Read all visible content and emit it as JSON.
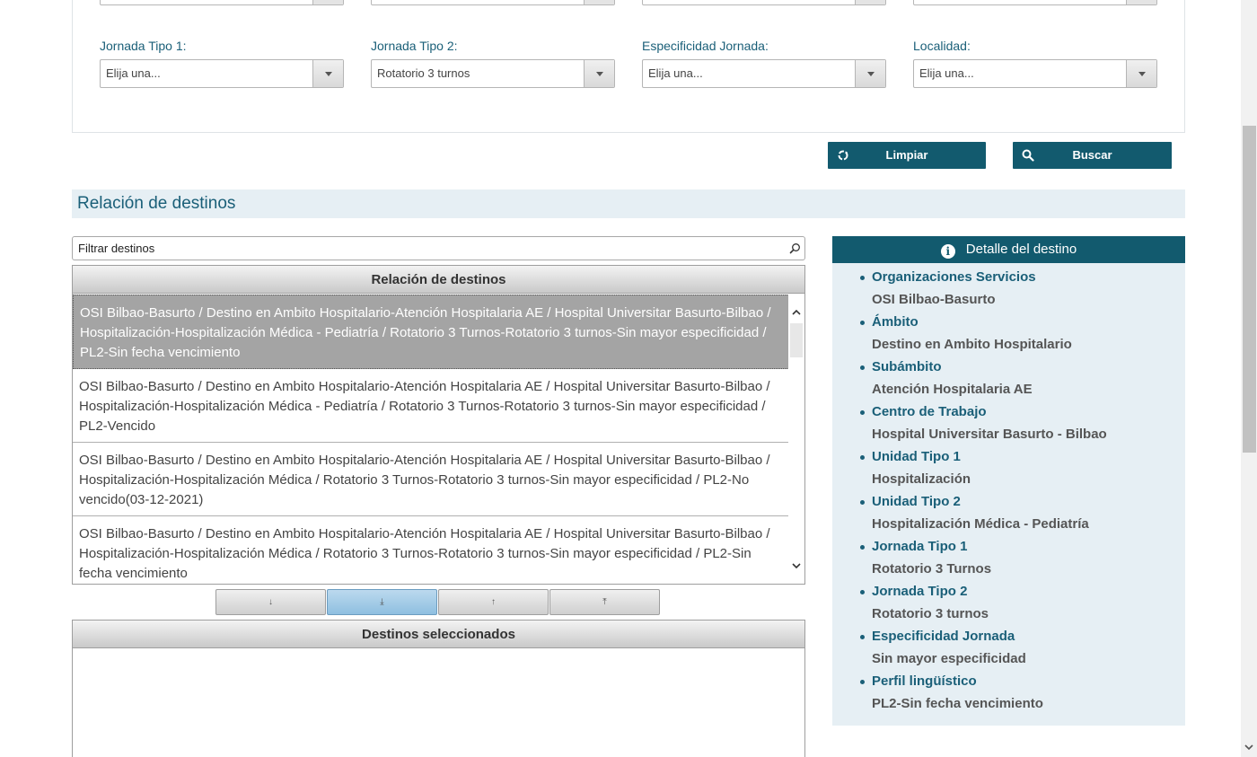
{
  "filters": {
    "fields": [
      {
        "label": "Jornada Tipo 1:",
        "value": "Elija una..."
      },
      {
        "label": "Jornada Tipo 2:",
        "value": "Rotatorio 3 turnos"
      },
      {
        "label": "Especificidad Jornada:",
        "value": "Elija una..."
      },
      {
        "label": "Localidad:",
        "value": "Elija una..."
      }
    ]
  },
  "buttons": {
    "clear": "Limpiar",
    "search": "Buscar"
  },
  "section": {
    "title": "Relación de destinos"
  },
  "filter_input": {
    "placeholder": "Filtrar destinos"
  },
  "list": {
    "header": "Relación de destinos",
    "items": [
      "OSI Bilbao-Basurto / Destino en Ambito Hospitalario-Atención Hospitalaria AE / Hospital Universitar Basurto-Bilbao / Hospitalización-Hospitalización Médica - Pediatría / Rotatorio 3 Turnos-Rotatorio 3 turnos-Sin mayor especificidad / PL2-Sin fecha vencimiento",
      "OSI Bilbao-Basurto / Destino en Ambito Hospitalario-Atención Hospitalaria AE / Hospital Universitar Basurto-Bilbao / Hospitalización-Hospitalización Médica - Pediatría / Rotatorio 3 Turnos-Rotatorio 3 turnos-Sin mayor especificidad / PL2-Vencido",
      "OSI Bilbao-Basurto / Destino en Ambito Hospitalario-Atención Hospitalaria AE / Hospital Universitar Basurto-Bilbao / Hospitalización-Hospitalización Médica / Rotatorio 3 Turnos-Rotatorio 3 turnos-Sin mayor especificidad / PL2-No vencido(03-12-2021)",
      "OSI Bilbao-Basurto / Destino en Ambito Hospitalario-Atención Hospitalaria AE / Hospital Universitar Basurto-Bilbao / Hospitalización-Hospitalización Médica / Rotatorio 3 Turnos-Rotatorio 3 turnos-Sin mayor especificidad / PL2-Sin fecha vencimiento"
    ],
    "selected_index": 0
  },
  "move_buttons": {
    "down": "↓",
    "down_all": "⤓",
    "up": "↑",
    "up_all": "⤒"
  },
  "selected_panel": {
    "header": "Destinos seleccionados"
  },
  "detail": {
    "header": "Detalle del destino",
    "items": [
      {
        "key": "Organizaciones Servicios",
        "value": "OSI Bilbao-Basurto"
      },
      {
        "key": "Ámbito",
        "value": "Destino en Ambito Hospitalario"
      },
      {
        "key": "Subámbito",
        "value": "Atención Hospitalaria AE"
      },
      {
        "key": "Centro de Trabajo",
        "value": "Hospital Universitar Basurto - Bilbao"
      },
      {
        "key": "Unidad Tipo 1",
        "value": "Hospitalización"
      },
      {
        "key": "Unidad Tipo 2",
        "value": "Hospitalización Médica - Pediatría"
      },
      {
        "key": "Jornada Tipo 1",
        "value": "Rotatorio 3 Turnos"
      },
      {
        "key": "Jornada Tipo 2",
        "value": "Rotatorio 3 turnos"
      },
      {
        "key": "Especificidad Jornada",
        "value": "Sin mayor especificidad"
      },
      {
        "key": "Perfil lingüístico",
        "value": "PL2-Sin fecha vencimiento"
      }
    ]
  },
  "colors": {
    "brand": "#125a6e",
    "label": "#1a5f78",
    "panel_bg": "#e6eff4",
    "selected_row": "#a4a4a4"
  }
}
